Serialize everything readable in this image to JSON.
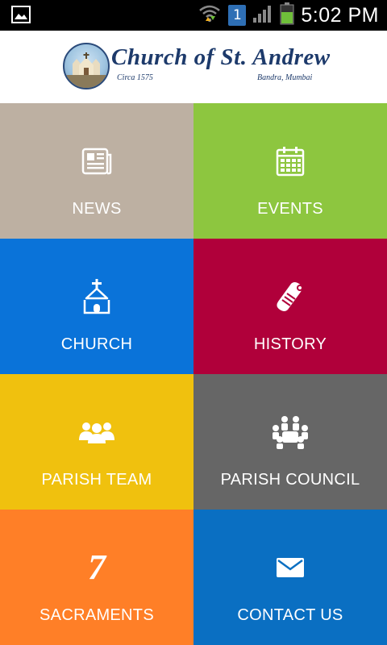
{
  "status_bar": {
    "time": "5:02 PM",
    "sim_slot": "1",
    "icons": [
      "gallery-icon",
      "wifi-icon",
      "sim-icon",
      "signal-icon",
      "battery-icon"
    ]
  },
  "header": {
    "logo_text": "Church of St. Andrew",
    "circa": "Circa 1575",
    "location": "Bandra, Mumbai"
  },
  "tiles": [
    {
      "label": "NEWS",
      "icon": "newspaper-icon",
      "color": "#bdb0a2"
    },
    {
      "label": "EVENTS",
      "icon": "calendar-icon",
      "color": "#8dc63f"
    },
    {
      "label": "CHURCH",
      "icon": "church-icon",
      "color": "#0a73d9"
    },
    {
      "label": "HISTORY",
      "icon": "scroll-icon",
      "color": "#b0003a"
    },
    {
      "label": "PARISH TEAM",
      "icon": "team-icon",
      "color": "#f0c10e"
    },
    {
      "label": "PARISH COUNCIL",
      "icon": "council-icon",
      "color": "#666666"
    },
    {
      "label": "SACRAMENTS",
      "icon": "seven-icon",
      "icon_text": "7",
      "color": "#ff7f27"
    },
    {
      "label": "CONTACT US",
      "icon": "mail-icon",
      "color": "#0a6fc2"
    }
  ]
}
